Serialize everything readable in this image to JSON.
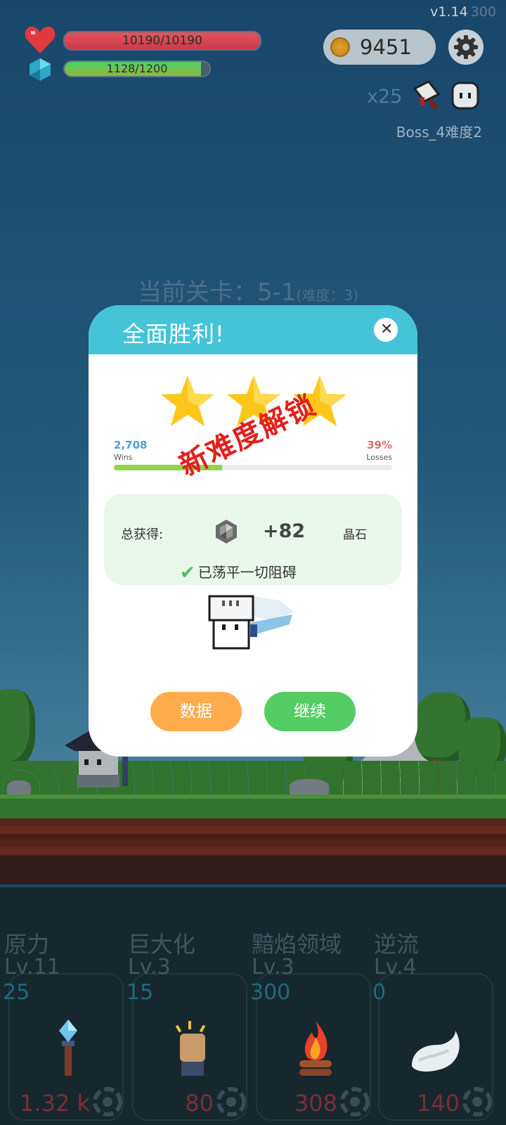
{
  "hud": {
    "version": "v1.14",
    "fps": "300",
    "hp_text": "10190/10190",
    "hp_fraction": 1.0,
    "mp_text": "1128/1200",
    "mp_fraction": 0.94,
    "coins": "9451",
    "boss_multiplier": "x25",
    "boss_label": "Boss_4难度2"
  },
  "stage": {
    "label": "当前关卡：5-1",
    "difficulty": "(难度：3)"
  },
  "dialog": {
    "title": "全面胜利!",
    "close_symbol": "✕",
    "stars_earned": 3,
    "wins_value": "2,708",
    "wins_label": "Wins",
    "losses_value": "39%",
    "losses_label": "Losses",
    "win_ratio": 0.39,
    "reward_label": "总获得:",
    "reward_value": "+82",
    "reward_unit": "晶石",
    "cleared_text": "已荡平一切阻碍",
    "stamp_text": "新难度解锁",
    "data_button": "数据",
    "continue_button": "继续"
  },
  "skills": [
    {
      "name": "原力",
      "level": "Lv.11",
      "count": "25",
      "cost": "1.32 k",
      "icon": "crystal-torch-icon"
    },
    {
      "name": "巨大化",
      "level": "Lv.3",
      "count": "15",
      "cost": "80",
      "icon": "fist-icon"
    },
    {
      "name": "黯焰领域",
      "level": "Lv.3",
      "count": "300",
      "cost": "308",
      "icon": "campfire-icon"
    },
    {
      "name": "逆流",
      "level": "Lv.4",
      "count": "0",
      "cost": "140",
      "icon": "wing-icon"
    }
  ],
  "colors": {
    "dialog_header": "#45c4d8",
    "data_button": "#ffac4d",
    "continue_button": "#53cd64",
    "stamp": "#e0201c",
    "star": "#ffc61a"
  }
}
